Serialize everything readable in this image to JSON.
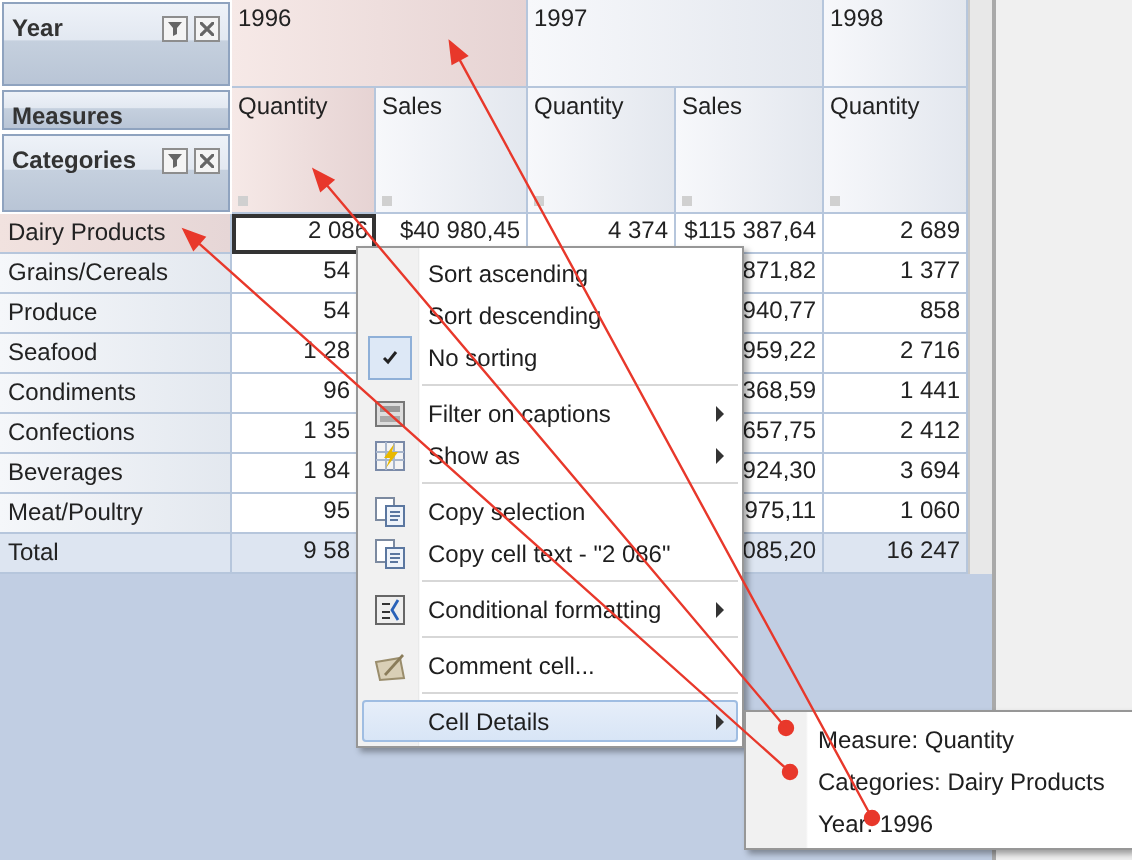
{
  "fields": [
    {
      "label": "Year",
      "has_buttons": true
    },
    {
      "label": "Measures",
      "has_buttons": false
    },
    {
      "label": "Categories",
      "has_buttons": true
    }
  ],
  "column_groups": [
    {
      "label": "1996",
      "selected": true,
      "measures": [
        {
          "label": "Quantity",
          "selected": true
        },
        {
          "label": "Sales",
          "selected": false
        }
      ]
    },
    {
      "label": "1997",
      "selected": false,
      "measures": [
        {
          "label": "Quantity",
          "selected": false
        },
        {
          "label": "Sales",
          "selected": false
        }
      ]
    },
    {
      "label": "1998",
      "selected": false,
      "measures": [
        {
          "label": "Quantity",
          "selected": false
        }
      ]
    }
  ],
  "rows": [
    {
      "label": "Dairy Products",
      "kind": "data",
      "selected": true,
      "cells": [
        {
          "text": "2 086",
          "focused": true,
          "clipped": false
        },
        {
          "text": "$40 980,45",
          "focused": false,
          "clipped": false
        },
        {
          "text": "4 374",
          "focused": false,
          "clipped": false
        },
        {
          "text": "$115 387,64",
          "focused": false,
          "clipped": false
        },
        {
          "text": "2 689",
          "focused": false,
          "clipped": false
        }
      ]
    },
    {
      "label": "Grains/Cereals",
      "kind": "data",
      "selected": false,
      "cells": [
        {
          "text": "54",
          "focused": false,
          "clipped": true
        },
        null,
        null,
        {
          "text": "871,82",
          "focused": false,
          "clipped": false
        },
        {
          "text": "1 377",
          "focused": false,
          "clipped": false
        }
      ]
    },
    {
      "label": "Produce",
      "kind": "data",
      "selected": false,
      "cells": [
        {
          "text": "54",
          "focused": false,
          "clipped": true
        },
        null,
        null,
        {
          "text": "940,77",
          "focused": false,
          "clipped": false
        },
        {
          "text": "858",
          "focused": false,
          "clipped": false
        }
      ]
    },
    {
      "label": "Seafood",
      "kind": "data",
      "selected": false,
      "cells": [
        {
          "text": "1 28",
          "focused": false,
          "clipped": true
        },
        null,
        null,
        {
          "text": "959,22",
          "focused": false,
          "clipped": false
        },
        {
          "text": "2 716",
          "focused": false,
          "clipped": false
        }
      ]
    },
    {
      "label": "Condiments",
      "kind": "data",
      "selected": false,
      "cells": [
        {
          "text": "96",
          "focused": false,
          "clipped": true
        },
        null,
        null,
        {
          "text": "368,59",
          "focused": false,
          "clipped": false
        },
        {
          "text": "1 441",
          "focused": false,
          "clipped": false
        }
      ]
    },
    {
      "label": "Confections",
      "kind": "data",
      "selected": false,
      "cells": [
        {
          "text": "1 35",
          "focused": false,
          "clipped": true
        },
        null,
        null,
        {
          "text": "657,75",
          "focused": false,
          "clipped": false
        },
        {
          "text": "2 412",
          "focused": false,
          "clipped": false
        }
      ]
    },
    {
      "label": "Beverages",
      "kind": "data",
      "selected": false,
      "cells": [
        {
          "text": "1 84",
          "focused": false,
          "clipped": true
        },
        null,
        null,
        {
          "text": "924,30",
          "focused": false,
          "clipped": false
        },
        {
          "text": "3 694",
          "focused": false,
          "clipped": false
        }
      ]
    },
    {
      "label": "Meat/Poultry",
      "kind": "data",
      "selected": false,
      "cells": [
        {
          "text": "95",
          "focused": false,
          "clipped": true
        },
        null,
        null,
        {
          "text": "975,11",
          "focused": false,
          "clipped": false
        },
        {
          "text": "1 060",
          "focused": false,
          "clipped": false
        }
      ]
    },
    {
      "label": "Total",
      "kind": "total",
      "selected": false,
      "cells": [
        {
          "text": "9 58",
          "focused": false,
          "clipped": true
        },
        null,
        null,
        {
          "text": "085,20",
          "focused": false,
          "clipped": false
        },
        {
          "text": "16 247",
          "focused": false,
          "clipped": false
        }
      ]
    }
  ],
  "context_menu": {
    "groups": [
      [
        {
          "label": "Sort ascending",
          "kind": "sort",
          "checked": false,
          "has_submenu": false,
          "selected": false
        },
        {
          "label": "Sort descending",
          "kind": "sort",
          "checked": false,
          "has_submenu": false,
          "selected": false
        },
        {
          "label": "No sorting",
          "kind": "sort",
          "checked": true,
          "has_submenu": false,
          "selected": false
        }
      ],
      [
        {
          "label": "Filter on captions",
          "kind": "filter",
          "has_submenu": true,
          "selected": false
        },
        {
          "label": "Show as",
          "kind": "show-as",
          "has_submenu": true,
          "selected": false
        }
      ],
      [
        {
          "label": "Copy selection",
          "kind": "copy",
          "has_submenu": false,
          "selected": false
        },
        {
          "label": "Copy cell text - \"2 086\"",
          "kind": "copy",
          "has_submenu": false,
          "selected": false
        }
      ],
      [
        {
          "label": "Conditional formatting",
          "kind": "conditional",
          "has_submenu": true,
          "selected": false
        }
      ],
      [
        {
          "label": "Comment cell...",
          "kind": "comment",
          "has_submenu": false,
          "selected": false
        }
      ],
      [
        {
          "label": "Cell Details",
          "kind": "plain",
          "has_submenu": true,
          "selected": true
        }
      ]
    ]
  },
  "submenu": {
    "items": [
      "Measure: Quantity",
      "Categories: Dairy Products",
      "Year: 1996"
    ]
  }
}
